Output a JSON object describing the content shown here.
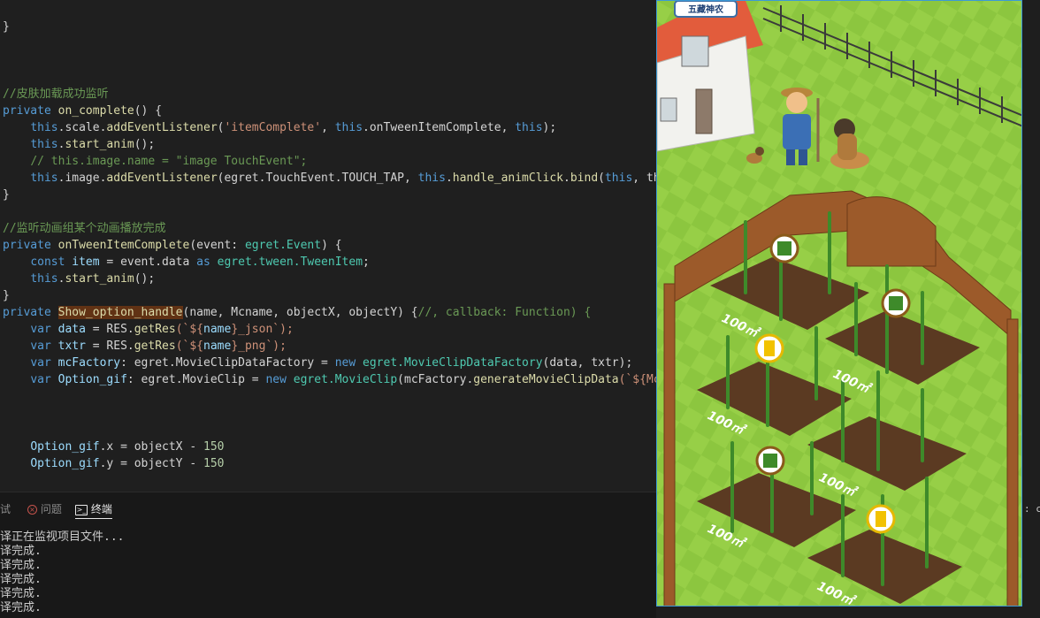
{
  "editor": {
    "l1": "}",
    "l2_comment": "//皮肤加载成功监听",
    "l3": {
      "kw": "private",
      "fn": "on_complete",
      "rest": "() {"
    },
    "l4": {
      "a": "this",
      "b": ".scale.",
      "c": "addEventListener",
      "d": "(",
      "e": "'itemComplete'",
      "f": ", ",
      "g": "this",
      "h": ".onTweenItemComplete, ",
      "i": "this",
      "j": ");"
    },
    "l5": {
      "a": "this",
      "b": ".",
      "c": "start_anim",
      "d": "();"
    },
    "l6_comment": "// this.image.name = \"image TouchEvent\";",
    "l7": {
      "a": "this",
      "b": ".image.",
      "c": "addEventListener",
      "d": "(egret.TouchEvent.TOUCH_TAP, ",
      "e": "this",
      "f": ".",
      "g": "handle_animClick",
      "h": ".",
      "i": "bind",
      "j": "(",
      "k": "this",
      ",l": ", thi"
    },
    "l8": "}",
    "l9_comment": "//监听动画组某个动画播放完成",
    "l10": {
      "kw": "private",
      "fn": "onTweenItemComplete",
      "p": "(event: ",
      "t": "egret.Event",
      "r": ") {"
    },
    "l11": {
      "kw": "const",
      "v": "item",
      "e": " = event.data ",
      "as": "as",
      "t": " egret.tween.TweenItem",
      "end": ";"
    },
    "l12": {
      "a": "this",
      "b": ".",
      "c": "start_anim",
      "d": "();"
    },
    "l13": "}",
    "l14": {
      "kw": "private",
      "fn": "Show_option_handle",
      "p": "(name, Mcname, objectX, objectY) {",
      "cm": "//, callback: Function) {"
    },
    "l15": {
      "kw": "var",
      "v": "data",
      "e": " = RES.",
      "fn": "getRes",
      "p": "(`${",
      "n": "name",
      "s": "}_json`);"
    },
    "l16": {
      "kw": "var",
      "v": "txtr",
      "e": " = RES.",
      "fn": "getRes",
      "p": "(`${",
      "n": "name",
      "s": "}_png`);"
    },
    "l17": {
      "kw": "var",
      "v": "mcFactory",
      "e": ": egret.MovieClipDataFactory = ",
      "new": "new",
      "t": " egret.MovieClipDataFactory",
      "r": "(data, txtr);"
    },
    "l18": {
      "kw": "var",
      "v": "Option_gif",
      "e": ": egret.MovieClip = ",
      "new": "new",
      "t": " egret.MovieClip",
      "r": "(mcFactory.",
      "fn": "generateMovieClipData",
      "s": "(`${Mcn"
    },
    "l19": {
      "v": "Option_gif",
      "e": ".x = objectX - ",
      "n": "150"
    },
    "l20": {
      "v": "Option_gif",
      "e": ".y = objectY - ",
      "n": "150"
    }
  },
  "panel": {
    "tabs": [
      "试",
      "问题",
      "终端"
    ],
    "terminal_lines": [
      "译正在监视项目文件...",
      "译完成.",
      "译完成.",
      "译完成.",
      "译完成.",
      "译完成."
    ]
  },
  "game": {
    "sign_text": "五藏神农",
    "plot_label": "100㎡",
    "plot_labels": [
      "100㎡",
      "100㎡",
      "100㎡",
      "100㎡",
      "100㎡",
      "100㎡"
    ]
  },
  "edge_text": ": cn",
  "colors": {
    "accent": "#3c9ad6",
    "grass": "#8cc63f",
    "soil": "#5b3a22"
  }
}
